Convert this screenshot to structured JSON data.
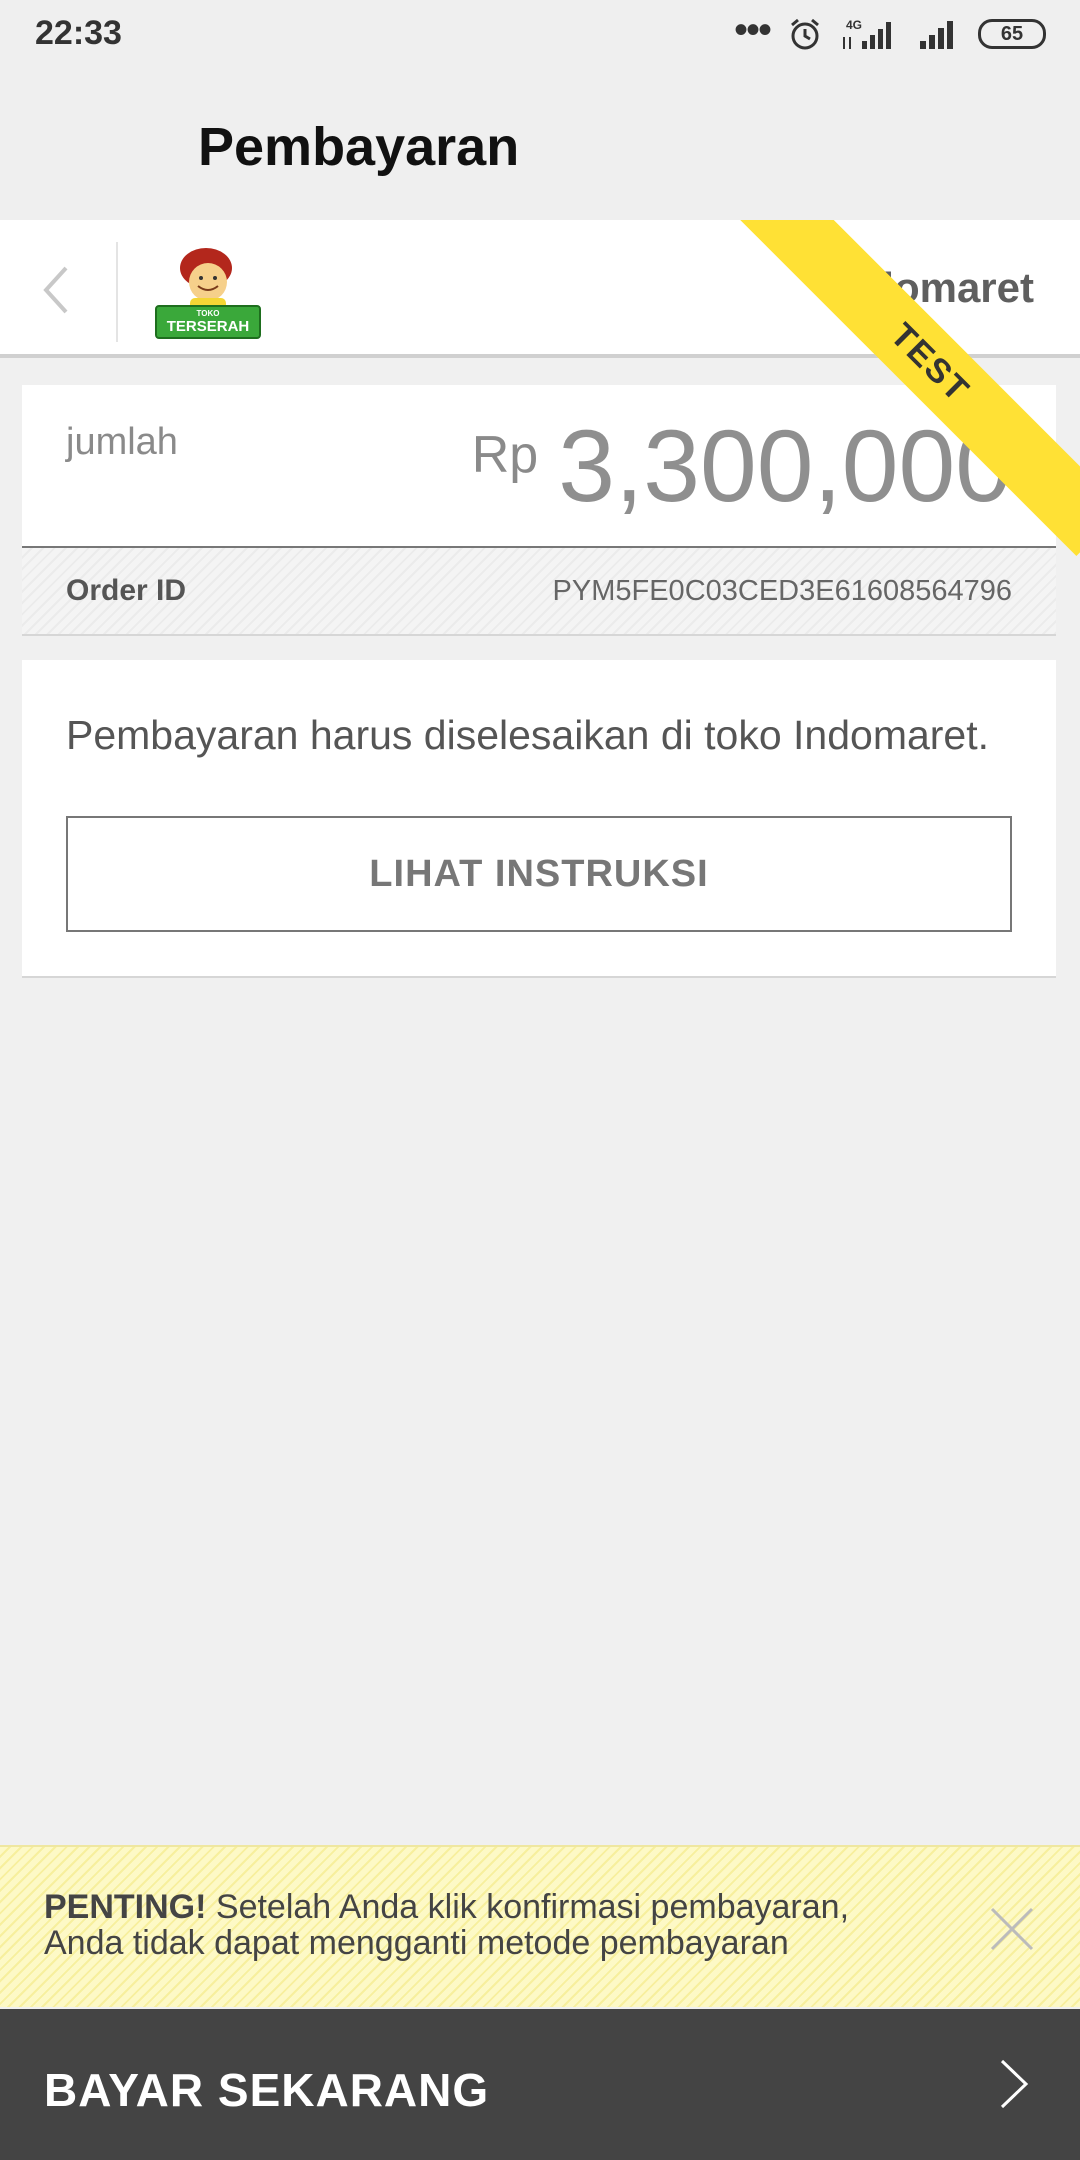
{
  "status_bar": {
    "time": "22:33",
    "network_label": "4G",
    "battery_level": "65",
    "icons": [
      "more-dots-icon",
      "alarm-icon",
      "signal-4g-icon",
      "signal-icon",
      "battery-icon"
    ]
  },
  "header": {
    "title": "Pembayaran"
  },
  "merchant": {
    "back_icon": "chevron-left-icon",
    "logo_icon": "toko-terserah-logo",
    "logo_text_small": "TOKO",
    "logo_text_big": "TERSERAH",
    "payment_method": "Indomaret",
    "ribbon": "TEST"
  },
  "amount": {
    "label": "jumlah",
    "currency": "Rp",
    "value": "3,300,000"
  },
  "order": {
    "label": "Order ID",
    "value": "PYM5FE0C03CED3E61608564796"
  },
  "info": {
    "text": "Pembayaran harus diselesaikan di toko Indomaret.",
    "button_label": "LIHAT INSTRUKSI"
  },
  "warning": {
    "strong": "PENTING!",
    "line1": " Setelah Anda klik konfirmasi pembayaran,",
    "line2": "Anda tidak dapat mengganti metode pembayaran",
    "close_icon": "close-icon"
  },
  "pay": {
    "label": "BAYAR SEKARANG",
    "arrow_icon": "chevron-right-icon"
  },
  "colors": {
    "ribbon": "#ffe135",
    "pay_bar": "#444444",
    "warning_bg": "#fdf9c6",
    "page_bg": "#f0f0f0"
  }
}
